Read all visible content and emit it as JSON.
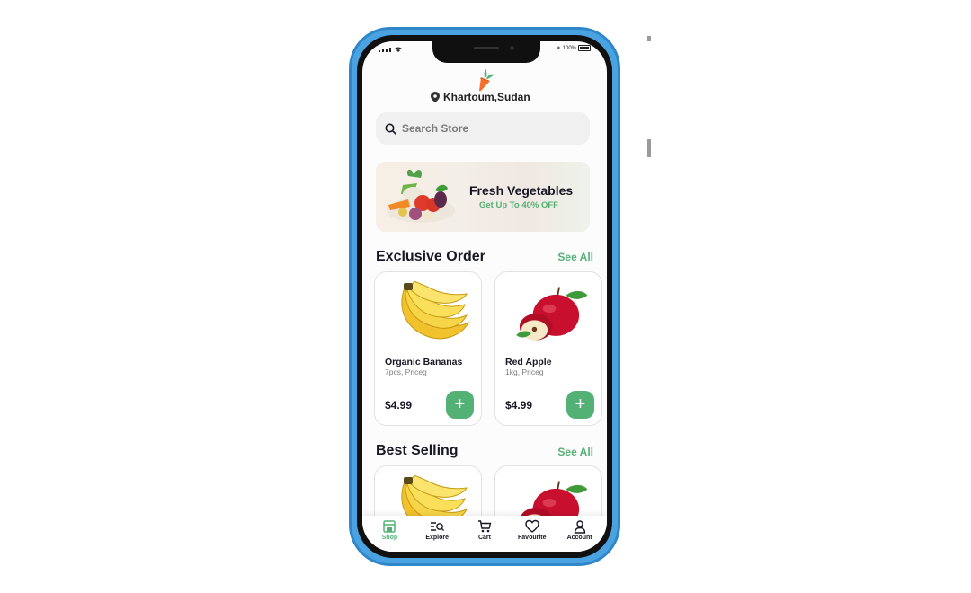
{
  "status_bar": {
    "battery": "100%"
  },
  "header": {
    "location": "Khartoum,Sudan"
  },
  "search": {
    "placeholder": "Search Store"
  },
  "banner": {
    "title": "Fresh Vegetables",
    "subtitle": "Get Up To 40%  OFF"
  },
  "sections": [
    {
      "title": "Exclusive Order",
      "see_all": "See All",
      "products": [
        {
          "name": "Organic Bananas",
          "detail": "7pcs, Priceg",
          "price": "$4.99",
          "icon": "banana-image"
        },
        {
          "name": "Red Apple",
          "detail": "1kg, Priceg",
          "price": "$4.99",
          "icon": "apple-image"
        }
      ]
    },
    {
      "title": "Best Selling",
      "see_all": "See All"
    }
  ],
  "tabbar": [
    {
      "label": "Shop",
      "icon": "shop-icon",
      "active": true
    },
    {
      "label": "Explore",
      "icon": "explore-icon",
      "active": false
    },
    {
      "label": "Cart",
      "icon": "cart-icon",
      "active": false
    },
    {
      "label": "Favourite",
      "icon": "heart-icon",
      "active": false
    },
    {
      "label": "Account",
      "icon": "account-icon",
      "active": false
    }
  ],
  "colors": {
    "accent": "#53b175",
    "phone_frame": "#4aa3e0",
    "text": "#181725"
  }
}
